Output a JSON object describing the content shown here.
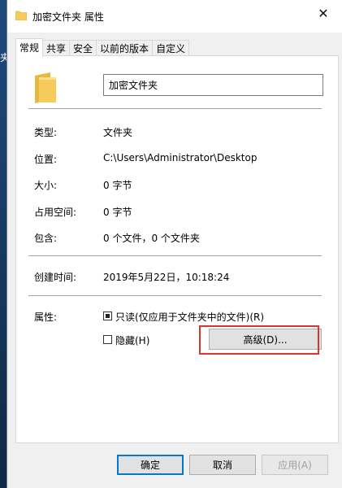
{
  "desktop": {
    "edge_glyph": "夹"
  },
  "window": {
    "title": "加密文件夹 属性",
    "close_glyph": "✕"
  },
  "tabs": [
    {
      "label": "常规",
      "active": true
    },
    {
      "label": "共享"
    },
    {
      "label": "安全"
    },
    {
      "label": "以前的版本"
    },
    {
      "label": "自定义"
    }
  ],
  "general": {
    "name_value": "加密文件夹",
    "rows": {
      "type": {
        "label": "类型:",
        "value": "文件夹"
      },
      "location": {
        "label": "位置:",
        "value": "C:\\Users\\Administrator\\Desktop"
      },
      "size": {
        "label": "大小:",
        "value": "0 字节"
      },
      "size_on_disk": {
        "label": "占用空间:",
        "value": "0 字节"
      },
      "contains": {
        "label": "包含:",
        "value": "0 个文件，0 个文件夹"
      },
      "created": {
        "label": "创建时间:",
        "value": "2019年5月22日，10:18:24"
      }
    },
    "attributes_label": "属性:",
    "readonly_label": "只读(仅应用于文件夹中的文件)(R)",
    "readonly_state": "checked",
    "hidden_label": "隐藏(H)",
    "hidden_state": "unchecked",
    "advanced_label": "高级(D)..."
  },
  "buttons": {
    "ok": "确定",
    "cancel": "取消",
    "apply": "应用(A)"
  },
  "colors": {
    "highlight_box": "#d9352f",
    "default_button_border": "#0078d7",
    "folder_yellow": "#f5cb5c"
  }
}
